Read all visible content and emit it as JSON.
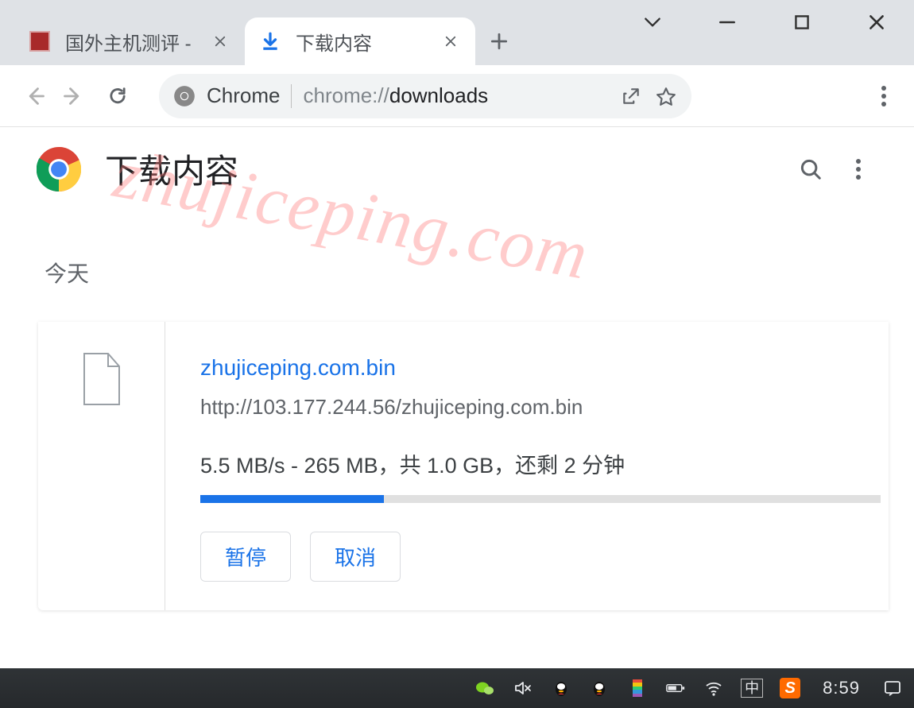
{
  "window": {
    "tabs": [
      {
        "title": "国外主机测评 -",
        "active": false
      },
      {
        "title": "下载内容",
        "active": true
      }
    ]
  },
  "toolbar": {
    "chrome_label": "Chrome",
    "url_prefix": "chrome://",
    "url_page": "downloads"
  },
  "page": {
    "title": "下载内容",
    "section_today": "今天",
    "watermark": "zhujiceping.com"
  },
  "download": {
    "filename": "zhujiceping.com.bin",
    "url": "http://103.177.244.56/zhujiceping.com.bin",
    "status": "5.5 MB/s - 265 MB，共 1.0 GB，还剩 2 分钟",
    "progress_percent": 27,
    "pause_label": "暂停",
    "cancel_label": "取消"
  },
  "taskbar": {
    "ime": "中",
    "sogou": "S",
    "clock": "8:59"
  }
}
